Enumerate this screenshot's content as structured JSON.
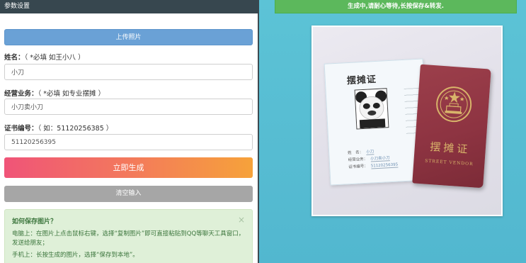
{
  "left": {
    "header": "参数设置",
    "upload_label": "上传照片",
    "fields": [
      {
        "label": "姓名：",
        "hint": "（ *必填 如王小八 ）",
        "value": "小刀"
      },
      {
        "label": "经营业务：",
        "hint": "（ *必填 如专业摆摊 ）",
        "value": "小刀卖小刀"
      },
      {
        "label": "证书编号：",
        "hint": "（ 如：51120256385 ）",
        "value": "51120256395"
      }
    ],
    "generate_label": "立即生成",
    "clear_label": "清空输入",
    "tip": {
      "title": "如何保存图片？",
      "close": "×",
      "line1": "电脑上：在图片上点击鼠标右键，选择“复制图片”即可直接粘贴到QQ等聊天工具窗口，发送给朋友；",
      "line2": "手机上：长按生成的图片，选择“保存到本地”。"
    }
  },
  "right": {
    "banner": "生成中,请耐心等待,长按保存&转发.",
    "card": {
      "title": "摆摊证",
      "name_label": "姓　名：",
      "name_value": "小刀",
      "business_label": "经营业务：",
      "business_value": "小刀卖小刀",
      "number_label": "证书编号：",
      "number_value": "51120256395"
    },
    "passport": {
      "title": "摆摊证",
      "subtitle": "STREET VENDOR"
    }
  },
  "colors": {
    "header_bg": "#37474f",
    "upload_btn": "#6aa1d6",
    "generate_gradient_start": "#f05478",
    "generate_gradient_end": "#f6a23a",
    "clear_btn": "#a6a6a6",
    "tip_bg": "#dff0d8",
    "right_bg": "#5cc3d6",
    "banner_bg": "#5cb85c",
    "passport_red": "#8e3442",
    "passport_gold": "#d8b46a"
  }
}
